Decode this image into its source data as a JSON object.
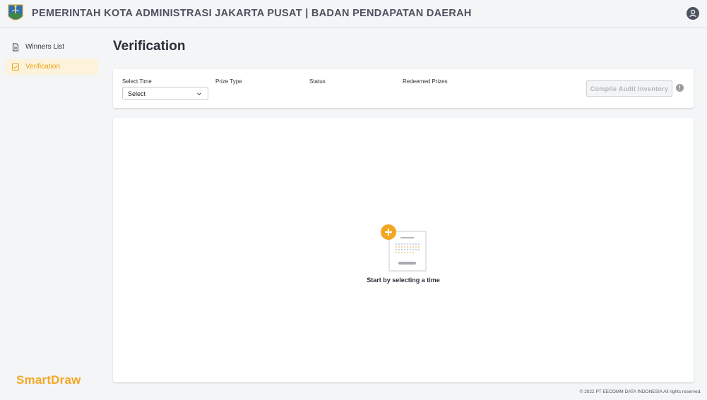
{
  "header": {
    "title": "PEMERINTAH KOTA ADMINISTRASI JAKARTA PUSAT | BADAN PENDAPATAN DAERAH",
    "logo_icon": "city-emblem-icon",
    "user_icon": "user-icon"
  },
  "sidebar": {
    "items": [
      {
        "label": "Winners List",
        "icon": "document-icon",
        "active": false
      },
      {
        "label": "Verification",
        "icon": "checkbox-icon",
        "active": true
      }
    ],
    "brand": "SmartDraw"
  },
  "page": {
    "title": "Verification"
  },
  "filters": {
    "select_time_label": "Select Time",
    "select_time_value": "Select",
    "prize_type_label": "Prize Type",
    "status_label": "Status",
    "redeemed_label": "Redeemed Prizes",
    "compile_button": "Compile Audit Inventory",
    "info_icon": "!"
  },
  "empty_state": {
    "message": "Start by selecting a time",
    "icon": "calendar-add-icon"
  },
  "footer": {
    "text": "© 2022 PT EECOMM DATA INDONESIA All rights reserved."
  },
  "colors": {
    "accent": "#f4a623",
    "active_bg": "#fdf3dc",
    "header_text": "#4d5260"
  }
}
